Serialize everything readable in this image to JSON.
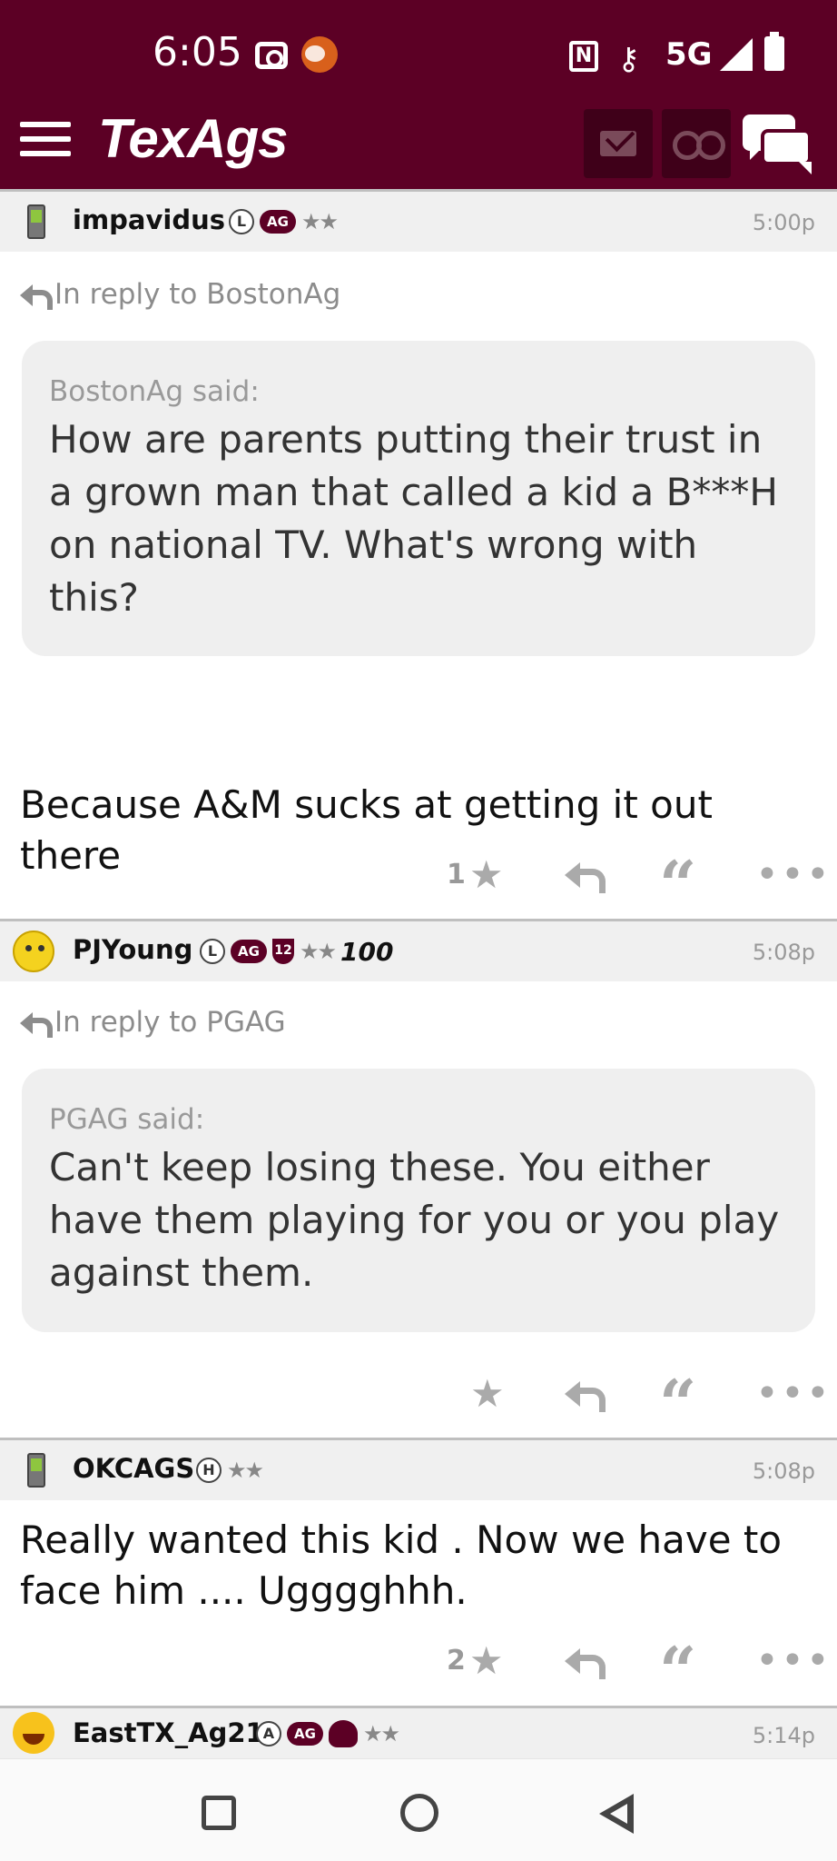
{
  "status_bar": {
    "time": "6:05",
    "network": "5G",
    "icons": [
      "camera-icon",
      "sports-ball-icon",
      "nfc-icon",
      "key-icon",
      "signal-icon",
      "battery-icon"
    ]
  },
  "header": {
    "logo": "TexAgs",
    "brand_color": "#5c0025",
    "icons": [
      "menu-icon",
      "mail-icon",
      "binoculars-icon",
      "chat-icon"
    ]
  },
  "posts": [
    {
      "username": "impavidus",
      "badges": [
        "L",
        "AG"
      ],
      "stars": "★★",
      "time": "5:00p",
      "reply_to": "In reply to BostonAg",
      "quote_author": "BostonAg said:",
      "quote_text": "How are parents putting their trust in a grown man that called a kid a B***H on national TV. What's wrong with this?",
      "body": "Because A&M sucks at getting it out there",
      "star_count": "1"
    },
    {
      "username": "PJYoung",
      "badges": [
        "L",
        "AG",
        "12"
      ],
      "stars": "★★",
      "extra": "100",
      "time": "5:08p",
      "reply_to": "In reply to PGAG",
      "quote_author": "PGAG said:",
      "quote_text": "Can't keep losing these. You either have them playing for you or you play against them.",
      "body": "",
      "star_count": ""
    },
    {
      "username": "OKCAGS",
      "badges": [
        "H"
      ],
      "stars": "★★",
      "time": "5:08p",
      "body": "Really wanted this kid . Now we have to face him .... Ugggghhh.",
      "star_count": "2"
    },
    {
      "username": "EastTX_Ag21",
      "badges": [
        "A",
        "AG"
      ],
      "stars": "★★",
      "time": "5:14p"
    }
  ],
  "actions": {
    "star": "★",
    "quote": "“",
    "more": "•••"
  },
  "nav": [
    "recents-button",
    "home-button",
    "back-button"
  ]
}
